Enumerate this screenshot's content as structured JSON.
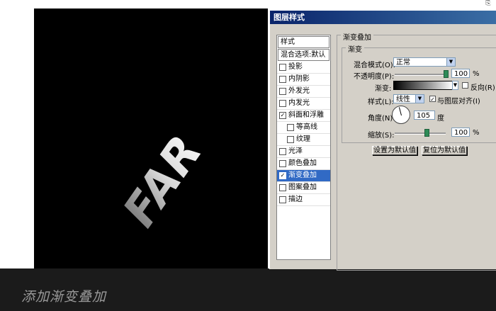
{
  "page": {
    "corner_icon": "toolbar-icon"
  },
  "canvas": {
    "artwork_text": "FAR"
  },
  "caption": "添加渐变叠加",
  "dialog": {
    "title": "图层样式",
    "styles_header": "样式",
    "blend_options": "混合选项:默认",
    "items": [
      {
        "label": "投影",
        "checked": false,
        "sub": false,
        "selected": false
      },
      {
        "label": "内阴影",
        "checked": false,
        "sub": false,
        "selected": false
      },
      {
        "label": "外发光",
        "checked": false,
        "sub": false,
        "selected": false
      },
      {
        "label": "内发光",
        "checked": false,
        "sub": false,
        "selected": false
      },
      {
        "label": "斜面和浮雕",
        "checked": true,
        "sub": false,
        "selected": false
      },
      {
        "label": "等高线",
        "checked": false,
        "sub": true,
        "selected": false
      },
      {
        "label": "纹理",
        "checked": false,
        "sub": true,
        "selected": false
      },
      {
        "label": "光泽",
        "checked": false,
        "sub": false,
        "selected": false
      },
      {
        "label": "颜色叠加",
        "checked": false,
        "sub": false,
        "selected": false
      },
      {
        "label": "渐变叠加",
        "checked": true,
        "sub": false,
        "selected": true
      },
      {
        "label": "图案叠加",
        "checked": false,
        "sub": false,
        "selected": false
      },
      {
        "label": "描边",
        "checked": false,
        "sub": false,
        "selected": false
      }
    ],
    "panel_title": "渐变叠加",
    "group_title": "渐变",
    "blend_mode_label": "混合模式(O):",
    "blend_mode_value": "正常",
    "opacity_label": "不透明度(P):",
    "opacity_value": "100",
    "opacity_unit": "%",
    "opacity_level": 100,
    "gradient_label": "渐变:",
    "reverse_label": "反向(R)",
    "reverse_checked": false,
    "style_label": "样式(L):",
    "style_value": "线性",
    "align_label": "与图层对齐(I)",
    "align_checked": true,
    "angle_label": "角度(N):",
    "angle_value": "105",
    "angle_unit": "度",
    "scale_label": "缩放(S):",
    "scale_value": "100",
    "scale_unit": "%",
    "scale_level": 100,
    "btn_default": "设置为默认值",
    "btn_reset": "复位为默认值",
    "colors": {
      "selected_bg": "#316ac5",
      "titlebar": "#0a246a",
      "dialog_bg": "#d4d0c8"
    }
  }
}
